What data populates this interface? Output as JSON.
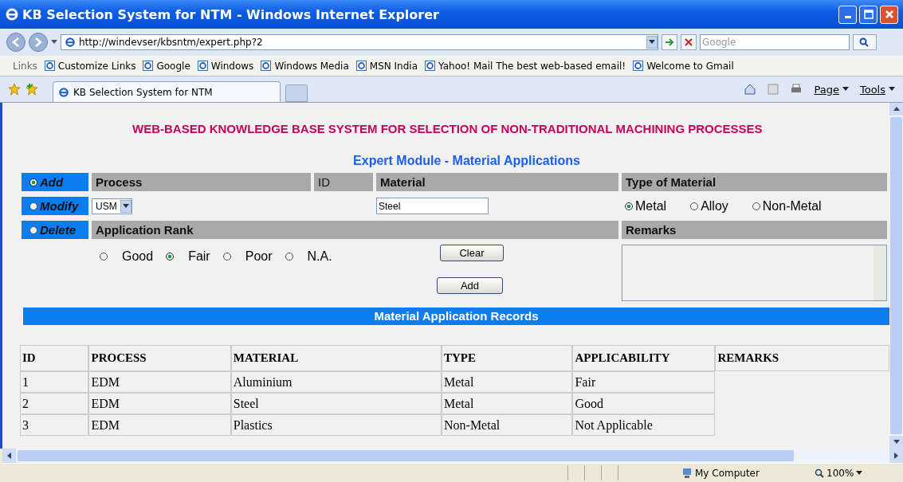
{
  "window": {
    "title": "KB Selection System for NTM - Windows Internet Explorer"
  },
  "address_bar": {
    "url": "http://windevser/kbsntm/expert.php?2",
    "search_placeholder": "Google"
  },
  "links": {
    "label": "Links",
    "items": [
      "Customize Links",
      "Google",
      "Windows",
      "Windows Media",
      "MSN India",
      "Yahoo! Mail The best web-based email!",
      "Welcome to Gmail"
    ]
  },
  "tab": {
    "title": "KB Selection System for NTM"
  },
  "commands": [
    "Page",
    "Tools"
  ],
  "page": {
    "title": "WEB-BASED KNOWLEDGE BASE SYSTEM FOR SELECTION OF NON-TRADITIONAL MACHINING PROCESSES",
    "subtitle": "Expert Module - Material Applications"
  },
  "modes": [
    {
      "label": "Add",
      "selected": true
    },
    {
      "label": "Modify",
      "selected": false
    },
    {
      "label": "Delete",
      "selected": false
    }
  ],
  "form": {
    "process_label": "Process",
    "process_value": "USM",
    "id_label": "ID",
    "material_label": "Material",
    "material_value": "Steel",
    "type_label": "Type of Material",
    "types": [
      {
        "label": "Metal",
        "selected": true
      },
      {
        "label": "Alloy",
        "selected": false
      },
      {
        "label": "Non-Metal",
        "selected": false
      }
    ],
    "rank_label": "Application Rank",
    "ranks": [
      {
        "label": "Good",
        "selected": false
      },
      {
        "label": "Fair",
        "selected": true
      },
      {
        "label": "Poor",
        "selected": false
      },
      {
        "label": "N.A.",
        "selected": false
      }
    ],
    "remarks_label": "Remarks",
    "clear_button": "Clear",
    "add_button": "Add"
  },
  "records": {
    "title": "Material Application Records",
    "columns": [
      "ID",
      "PROCESS",
      "MATERIAL",
      "TYPE",
      "APPLICABILITY",
      "REMARKS"
    ],
    "rows": [
      [
        "1",
        "EDM",
        "Aluminium",
        "Metal",
        "Fair"
      ],
      [
        "2",
        "EDM",
        "Steel",
        "Metal",
        "Good"
      ],
      [
        "3",
        "EDM",
        "Plastics",
        "Non-Metal",
        "Not Applicable"
      ]
    ]
  },
  "status_bar": {
    "zone": "My Computer",
    "zoom": "100%"
  }
}
